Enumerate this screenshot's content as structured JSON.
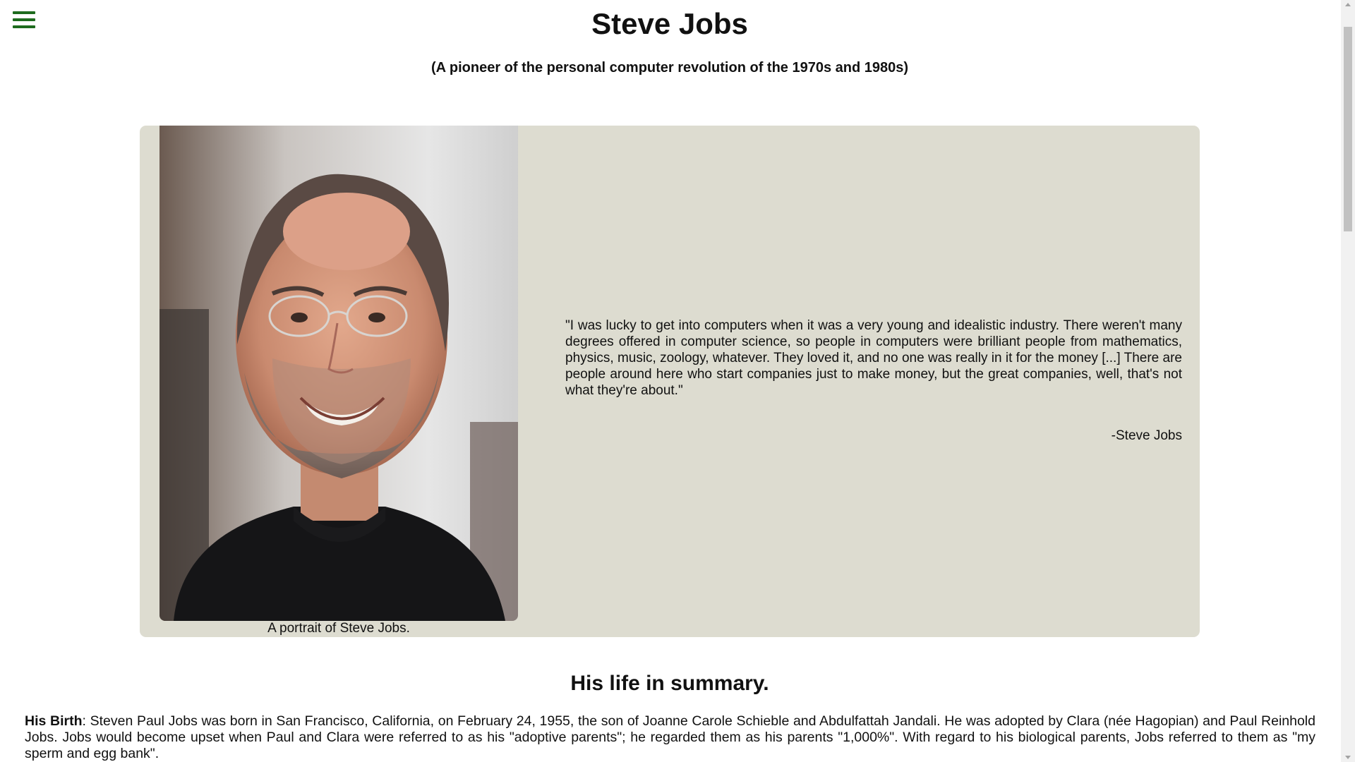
{
  "header": {
    "menu_icon": "hamburger-menu-icon",
    "title": "Steve Jobs",
    "subtitle": "(A pioneer of the personal computer revolution of the 1970s and 1980s)"
  },
  "hero": {
    "image_caption": "A portrait of Steve Jobs.",
    "quote": "\"I was lucky to get into computers when it was a very young and idealistic industry. There weren't many degrees offered in computer science, so people in computers were brilliant people from mathematics, physics, music, zoology, whatever. They loved it, and no one was really in it for the money [...] There are people around here who start companies just to make money, but the great companies, well, that's not what they're about.\"",
    "quote_author": "-Steve Jobs"
  },
  "summary": {
    "heading": "His life in summary.",
    "birth_label": "His Birth",
    "birth_text": ": Steven Paul Jobs was born in San Francisco, California, on February 24, 1955, the son of Joanne Carole Schieble and Abdulfattah Jandali. He was adopted by Clara (née Hagopian) and Paul Reinhold Jobs. Jobs would become upset when Paul and Clara were referred to as his \"adoptive parents\"; he regarded them as his parents \"1,000%\". With regard to his biological parents, Jobs referred to them as \"my sperm and egg bank\"."
  },
  "colors": {
    "menu_icon": "#1e6b1e",
    "hero_background": "#dddcd0",
    "page_background": "#ffffff",
    "text": "#111111"
  }
}
